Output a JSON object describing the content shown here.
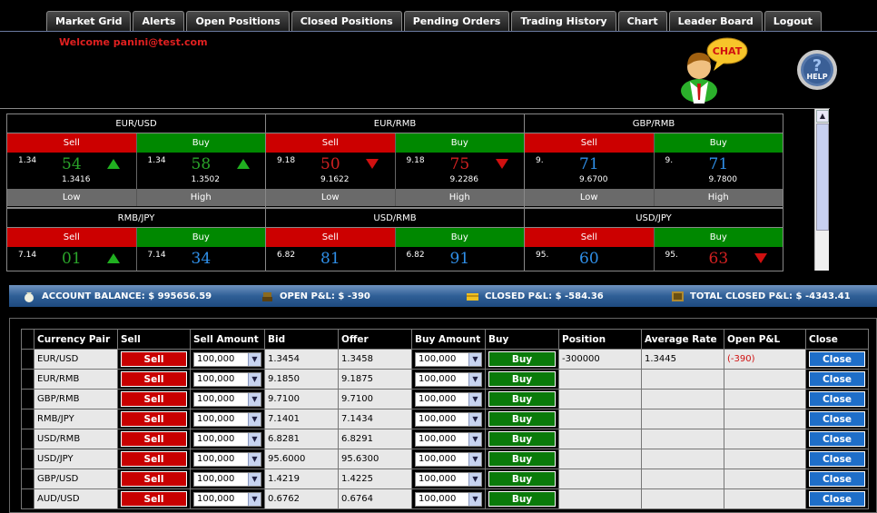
{
  "nav": {
    "tabs": [
      "Market Grid",
      "Alerts",
      "Open Positions",
      "Closed Positions",
      "Pending Orders",
      "Trading History",
      "Chart",
      "Leader Board",
      "Logout"
    ]
  },
  "header": {
    "welcome": "Welcome panini@test.com",
    "chat_label": "CHAT",
    "help_label": "HELP"
  },
  "grid": {
    "sell_label": "Sell",
    "buy_label": "Buy",
    "low_label": "Low",
    "high_label": "High",
    "pairs": [
      {
        "name": "EUR/USD",
        "sell": {
          "prefix": "1.34",
          "big": "54",
          "full": "1.3416",
          "dir": "up"
        },
        "buy": {
          "prefix": "1.34",
          "big": "58",
          "full": "1.3502",
          "dir": "up"
        }
      },
      {
        "name": "EUR/RMB",
        "sell": {
          "prefix": "9.18",
          "big": "50",
          "full": "9.1622",
          "dir": "down"
        },
        "buy": {
          "prefix": "9.18",
          "big": "75",
          "full": "9.2286",
          "dir": "down"
        }
      },
      {
        "name": "GBP/RMB",
        "sell": {
          "prefix": "9.",
          "big": "71",
          "full": "9.6700",
          "dir": "flat"
        },
        "buy": {
          "prefix": "9.",
          "big": "71",
          "full": "9.7800",
          "dir": "flat"
        }
      },
      {
        "name": "RMB/JPY",
        "sell": {
          "prefix": "7.14",
          "big": "01",
          "full": "",
          "dir": "up"
        },
        "buy": {
          "prefix": "7.14",
          "big": "34",
          "full": "",
          "dir": "flat"
        }
      },
      {
        "name": "USD/RMB",
        "sell": {
          "prefix": "6.82",
          "big": "81",
          "full": "",
          "dir": "flat"
        },
        "buy": {
          "prefix": "6.82",
          "big": "91",
          "full": "",
          "dir": "flat"
        }
      },
      {
        "name": "USD/JPY",
        "sell": {
          "prefix": "95.",
          "big": "60",
          "full": "",
          "dir": "flat"
        },
        "buy": {
          "prefix": "95.",
          "big": "63",
          "full": "",
          "dir": "down"
        }
      }
    ]
  },
  "account": {
    "balance": "ACCOUNT BALANCE: $ 995656.59",
    "open_pl": "OPEN P&L: $ -390",
    "closed_pl": "CLOSED P&L: $ -584.36",
    "total_closed_pl": "TOTAL CLOSED P&L: $ -4343.41"
  },
  "table": {
    "headers": [
      "Currency Pair",
      "Sell",
      "Sell Amount",
      "Bid",
      "Offer",
      "Buy Amount",
      "Buy",
      "Position",
      "Average Rate",
      "Open P&L",
      "Close"
    ],
    "sell_btn": "Sell",
    "buy_btn": "Buy",
    "close_btn": "Close",
    "rows": [
      {
        "pair": "EUR/USD",
        "sell_amount": "100,000",
        "bid": "1.3454",
        "offer": "1.3458",
        "buy_amount": "100,000",
        "position": "-300000",
        "avg_rate": "1.3445",
        "open_pl": "(-390)"
      },
      {
        "pair": "EUR/RMB",
        "sell_amount": "100,000",
        "bid": "9.1850",
        "offer": "9.1875",
        "buy_amount": "100,000",
        "position": "",
        "avg_rate": "",
        "open_pl": ""
      },
      {
        "pair": "GBP/RMB",
        "sell_amount": "100,000",
        "bid": "9.7100",
        "offer": "9.7100",
        "buy_amount": "100,000",
        "position": "",
        "avg_rate": "",
        "open_pl": ""
      },
      {
        "pair": "RMB/JPY",
        "sell_amount": "100,000",
        "bid": "7.1401",
        "offer": "7.1434",
        "buy_amount": "100,000",
        "position": "",
        "avg_rate": "",
        "open_pl": ""
      },
      {
        "pair": "USD/RMB",
        "sell_amount": "100,000",
        "bid": "6.8281",
        "offer": "6.8291",
        "buy_amount": "100,000",
        "position": "",
        "avg_rate": "",
        "open_pl": ""
      },
      {
        "pair": "USD/JPY",
        "sell_amount": "100,000",
        "bid": "95.6000",
        "offer": "95.6300",
        "buy_amount": "100,000",
        "position": "",
        "avg_rate": "",
        "open_pl": ""
      },
      {
        "pair": "GBP/USD",
        "sell_amount": "100,000",
        "bid": "1.4219",
        "offer": "1.4225",
        "buy_amount": "100,000",
        "position": "",
        "avg_rate": "",
        "open_pl": ""
      },
      {
        "pair": "AUD/USD",
        "sell_amount": "100,000",
        "bid": "0.6762",
        "offer": "0.6764",
        "buy_amount": "100,000",
        "position": "",
        "avg_rate": "",
        "open_pl": ""
      }
    ]
  },
  "colors": {
    "sell": "#cc0000",
    "buy": "#008800",
    "close": "#1e6ec8",
    "up": "#2aa52a",
    "down": "#d02020",
    "flat": "#2f8fe8"
  }
}
